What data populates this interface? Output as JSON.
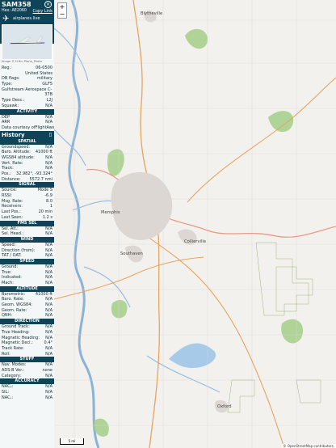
{
  "header": {
    "callsign": "SAM358",
    "hex_line": "Hex: AE2060",
    "copy_link": "Copy Link",
    "source": "airplanes.live",
    "photo_caption": "Image © H Bn, Plane_Photo"
  },
  "info": [
    {
      "k": "Reg.:",
      "v": "06-0500"
    },
    {
      "k": "",
      "v": "United States"
    },
    {
      "k": "DB flags:",
      "v": "military"
    },
    {
      "k": "Type:",
      "v": "GLF5"
    },
    {
      "k": "Gulfstream Aerospace C-",
      "v": ""
    },
    {
      "k": "",
      "v": "37B"
    },
    {
      "k": "Type Desc.:",
      "v": "L2J"
    },
    {
      "k": "Squawk:",
      "v": "N/A"
    }
  ],
  "sections": [
    {
      "title": "ACTIVITY",
      "rows": [
        {
          "k": "DEP",
          "v": "N/A"
        },
        {
          "k": "ARR",
          "v": "N/A"
        },
        {
          "k": "Data courtesy of",
          "v": "FlightAware"
        }
      ]
    }
  ],
  "history_title": "History",
  "groups": [
    {
      "title": "SPATIAL",
      "rows": [
        {
          "k": "Groundspeed:",
          "v": "N/A"
        },
        {
          "k": "Baro. Altitude:",
          "v": "41000 ft"
        },
        {
          "k": "WGS84 altitude:",
          "v": "N/A"
        },
        {
          "k": "Vert. Rate:",
          "v": "N/A"
        },
        {
          "k": "Track:",
          "v": "N/A"
        },
        {
          "k": "Pos.:",
          "v": "32.982°, -93.324°"
        },
        {
          "k": "Distance:",
          "v": "5572.7 nmi"
        }
      ]
    },
    {
      "title": "SIGNAL",
      "rows": [
        {
          "k": "Source:",
          "v": "Mode S"
        },
        {
          "k": "RSSI:",
          "v": "-6.9"
        },
        {
          "k": "Msg. Rate:",
          "v": "8.0"
        },
        {
          "k": "Receivers:",
          "v": "1"
        },
        {
          "k": "Last Pos.:",
          "v": "20 min"
        },
        {
          "k": "Last Seen:",
          "v": "1.2 s"
        }
      ]
    },
    {
      "title": "FMS SEL",
      "rows": [
        {
          "k": "Sel. Alt.:",
          "v": "N/A"
        },
        {
          "k": "Sel. Head.:",
          "v": "N/A"
        }
      ]
    },
    {
      "title": "WIND",
      "rows": [
        {
          "k": "Speed:",
          "v": "N/A"
        },
        {
          "k": "Direction (from):",
          "v": "N/A"
        },
        {
          "k": "TAT / OAT:",
          "v": "N/A"
        }
      ]
    },
    {
      "title": "SPEED",
      "rows": [
        {
          "k": "Ground:",
          "v": "N/A"
        },
        {
          "k": "True:",
          "v": "N/A"
        },
        {
          "k": "Indicated:",
          "v": "N/A"
        },
        {
          "k": "Mach:",
          "v": "N/A"
        }
      ]
    },
    {
      "title": "ALTITUDE",
      "rows": [
        {
          "k": "Barometric:",
          "v": "41000 ft"
        },
        {
          "k": "Baro. Rate:",
          "v": "N/A"
        },
        {
          "k": "Geom. WGS84:",
          "v": "N/A"
        },
        {
          "k": "Geom. Rate:",
          "v": "N/A"
        },
        {
          "k": "QNH:",
          "v": "N/A"
        }
      ]
    },
    {
      "title": "DIRECTION",
      "rows": [
        {
          "k": "Ground Track:",
          "v": "N/A"
        },
        {
          "k": "True Heading:",
          "v": "N/A"
        },
        {
          "k": "Magnetic Heading:",
          "v": "N/A"
        },
        {
          "k": "Magnetic Decl.:",
          "v": "0.4°"
        },
        {
          "k": "Track Rate:",
          "v": "N/A"
        },
        {
          "k": "Roll:",
          "v": "N/A"
        }
      ]
    },
    {
      "title": "STUFF",
      "rows": [
        {
          "k": "Nav. Modes:",
          "v": "N/A"
        },
        {
          "k": "ADS-B Ver.:",
          "v": "none"
        },
        {
          "k": "Category:",
          "v": "N/A"
        }
      ]
    },
    {
      "title": "ACCURACY",
      "rows": [
        {
          "k": "NACₚ:",
          "v": "N/A"
        },
        {
          "k": "SIL:",
          "v": "N/A"
        },
        {
          "k": "NACᵥ:",
          "v": "N/A"
        }
      ]
    }
  ],
  "map": {
    "cities": [
      {
        "name": "Blytheville"
      },
      {
        "name": "Memphis"
      },
      {
        "name": "Collierville"
      },
      {
        "name": "Southaven"
      },
      {
        "name": "Oxford"
      }
    ],
    "scale": "5 mi",
    "attribution": "© OpenStreetMap contributors."
  },
  "colors": {
    "panel_dark": "#0f4358",
    "accent": "#7ea2ad",
    "map_bg": "#f3f1ee"
  }
}
